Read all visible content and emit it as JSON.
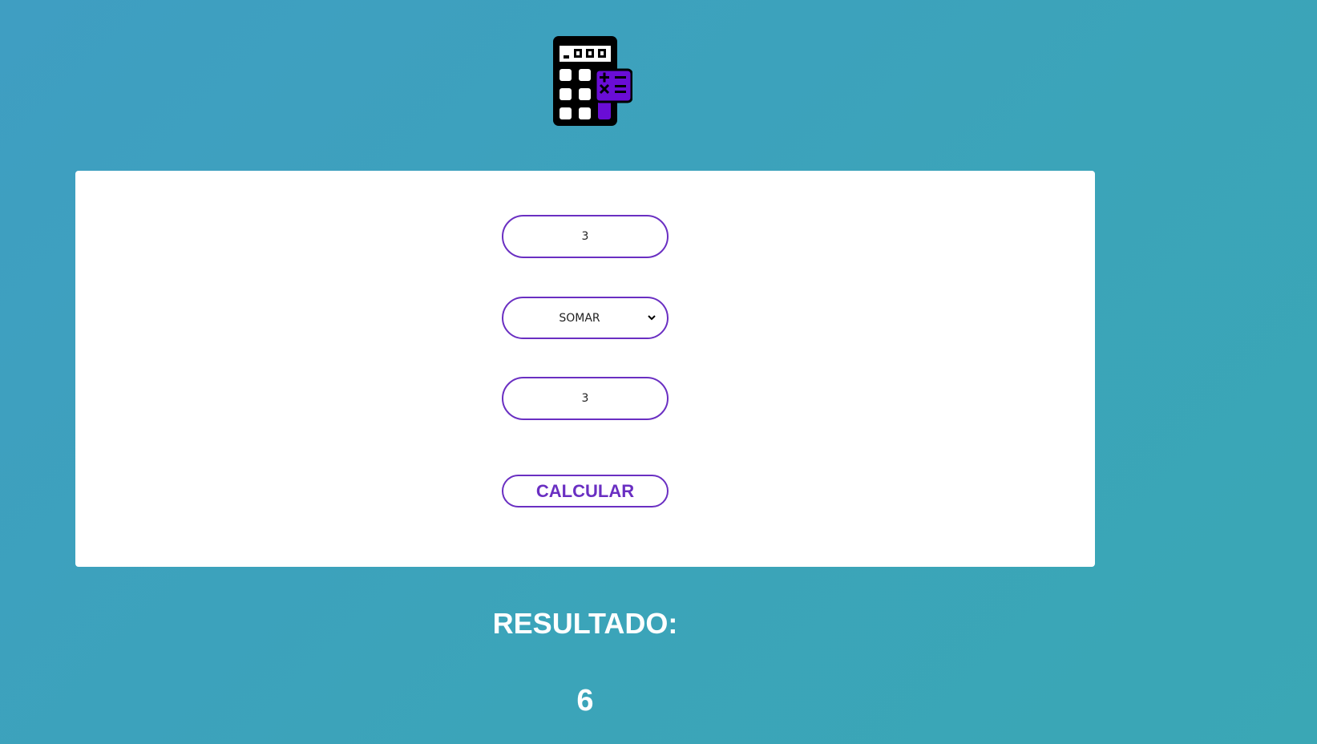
{
  "logo": {
    "icon": "calculator-icon",
    "accent_color": "#6a0dd6"
  },
  "form": {
    "first_number": "3",
    "operation": {
      "selected": "SOMAR"
    },
    "second_number": "3",
    "calculate_label": "CALCULAR"
  },
  "result": {
    "label": "RESULTADO:",
    "value": "6"
  },
  "colors": {
    "background": "#3ba4b9",
    "card": "#ffffff",
    "accent": "#6a2fc2",
    "text_light": "#ffffff"
  }
}
